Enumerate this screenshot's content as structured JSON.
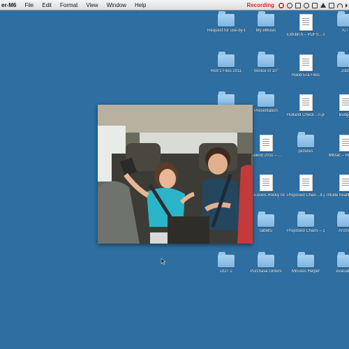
{
  "menubar": {
    "app_name": "er-M6",
    "menus": [
      "File",
      "Edit",
      "Format",
      "View",
      "Window",
      "Help"
    ],
    "recording_label": "Recording"
  },
  "colors": {
    "desktop": "#2f6ea0",
    "recording": "#d12a2a"
  },
  "desktop_icons": [
    {
      "label": "Request for use-by-bea",
      "type": "folder"
    },
    {
      "label": "My eMusic",
      "type": "folder"
    },
    {
      "label": "Exhibit A – PDFS…ss.pdf",
      "type": "document"
    },
    {
      "label": "ICT",
      "type": "folder"
    },
    {
      "label": "Rick's Files 2011",
      "type": "folder"
    },
    {
      "label": "Venice of 10\"",
      "type": "folder"
    },
    {
      "label": "Hand Era Files",
      "type": "document"
    },
    {
      "label": "Jobs",
      "type": "folder"
    },
    {
      "label": "Wrap Guide",
      "type": "folder"
    },
    {
      "label": "Presentation",
      "type": "folder"
    },
    {
      "label": "Holland Check…n.pdf",
      "type": "document"
    },
    {
      "label": "Budget",
      "type": "document"
    },
    {
      "label": "OT Items",
      "type": "folder"
    },
    {
      "label": "Calend 2011 – …",
      "type": "document"
    },
    {
      "label": "pictures",
      "type": "folder"
    },
    {
      "label": "MBrac – Rick Lust",
      "type": "document"
    },
    {
      "label": "end of",
      "type": "document"
    },
    {
      "label": "SE-Excels.Rocky Staff Ideas",
      "type": "document"
    },
    {
      "label": "Proposed Chair…it.pdf",
      "type": "document"
    },
    {
      "label": "Intuite health affiliat…Sites",
      "type": "document"
    },
    {
      "label": "music",
      "type": "folder"
    },
    {
      "label": "tablets",
      "type": "folder"
    },
    {
      "label": "Proposed Chairs – 2012",
      "type": "folder"
    },
    {
      "label": "Archive",
      "type": "folder"
    },
    {
      "label": "DOT 2",
      "type": "folder"
    },
    {
      "label": "Purchase Orders",
      "type": "folder"
    },
    {
      "label": "Minutes Helper",
      "type": "folder"
    },
    {
      "label": "evaluation",
      "type": "folder"
    }
  ]
}
